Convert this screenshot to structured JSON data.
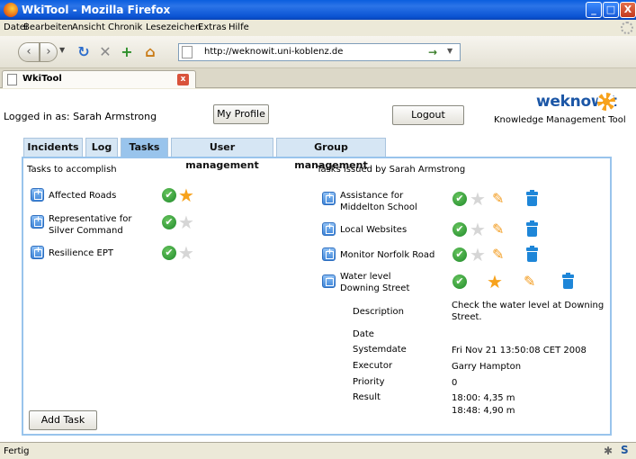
{
  "window": {
    "title": "WkiTool - Mozilla Firefox",
    "min_label": "_",
    "max_label": "□",
    "close_label": "X"
  },
  "menu": [
    "Datei",
    "Bearbeiten",
    "Ansicht",
    "Chronik",
    "Lesezeichen",
    "Extras",
    "Hilfe"
  ],
  "navbar": {
    "url": "http://weknowit.uni-koblenz.de"
  },
  "browser_tab": {
    "label": "WkiTool"
  },
  "header": {
    "logged_in": "Logged in as: Sarah Armstrong",
    "my_profile": "My Profile",
    "logout": "Logout",
    "brand": "weknowit",
    "brand_subtitle": "Knowledge Management Tool"
  },
  "tabs": [
    {
      "label": "Incidents"
    },
    {
      "label": "Log"
    },
    {
      "label": "Tasks",
      "active": true
    },
    {
      "label": "User management"
    },
    {
      "label": "Group management"
    }
  ],
  "left": {
    "title": "Tasks to accomplish",
    "tasks": [
      {
        "label": "Affected Roads",
        "starred": true
      },
      {
        "label": "Representative for Silver Command",
        "starred": false
      },
      {
        "label": "Resilience EPT",
        "starred": false
      }
    ],
    "add_task": "Add Task"
  },
  "right": {
    "title": "Tasks issued by Sarah Armstrong",
    "tasks": [
      {
        "label": "Assistance for Middelton School",
        "starred": false
      },
      {
        "label": "Local Websites",
        "starred": false
      },
      {
        "label": "Monitor Norfolk Road",
        "starred": false
      },
      {
        "label": "Water level Downing Street",
        "starred": true,
        "expanded": true
      }
    ],
    "details": {
      "description_key": "Description",
      "description_val": "Check the water level at Downing Street.",
      "date_key": "Date",
      "date_val": "",
      "systemdate_key": "Systemdate",
      "systemdate_val": "Fri Nov 21 13:50:08 CET 2008",
      "executor_key": "Executor",
      "executor_val": "Garry Hampton",
      "priority_key": "Priority",
      "priority_val": "0",
      "result_key": "Result",
      "result_line1": "18:00: 4,35 m",
      "result_line2": "18:48: 4,90 m"
    }
  },
  "status": {
    "text": "Fertig"
  },
  "icons": {
    "check": "✔",
    "star": "★",
    "star_empty": "☆",
    "pencil": "✎"
  },
  "colors": {
    "tab_active": "#99c4ec",
    "tab_inactive": "#d6e6f4",
    "brand": "#1b56a6",
    "star": "#f7a21c",
    "check": "#1f8a2a",
    "trash": "#1e86d8"
  }
}
